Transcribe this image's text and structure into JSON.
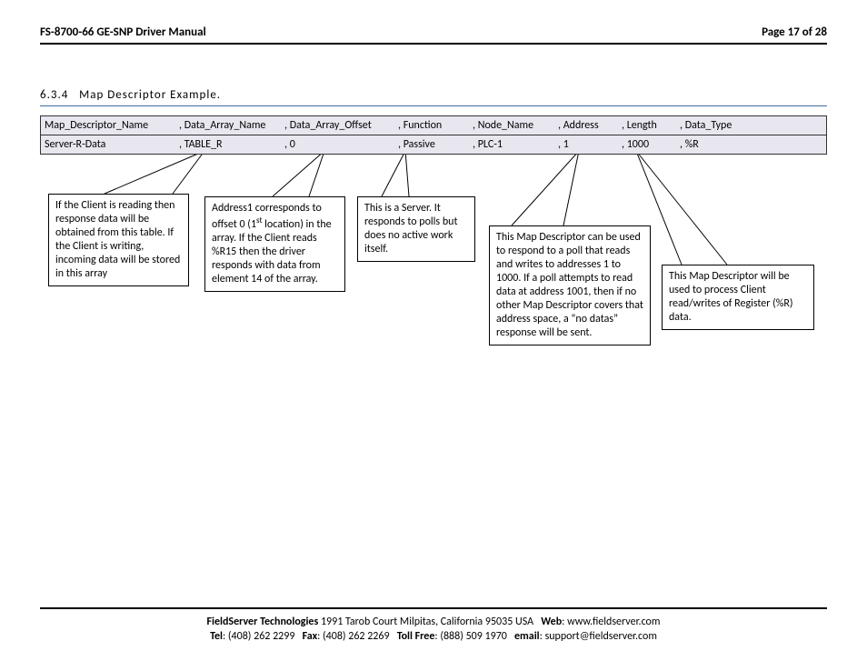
{
  "header": {
    "title": "FS-8700-66 GE-SNP Driver Manual",
    "page": "Page 17 of 28"
  },
  "section": {
    "number": "6.3.4",
    "title": "Map Descriptor Example."
  },
  "table": {
    "header": [
      "Map_Descriptor_Name",
      ", Data_Array_Name",
      ", Data_Array_Offset",
      ", Function",
      ", Node_Name",
      ", Address",
      ", Length",
      ", Data_Type"
    ],
    "row": [
      "Server-R-Data",
      ", TABLE_R",
      ", 0",
      ", Passive",
      ", PLC-1",
      ", 1",
      ", 1000",
      ", %R"
    ]
  },
  "callouts": [
    "If the Client is reading then response data will be obtained from this table. If the Client is writing, incoming data will be stored in this array",
    "Address1 corresponds to offset 0 (1st location) in the array. If the Client reads %R15 then the driver responds with data from element 14 of the array.",
    "This is a Server.  It responds to polls but does no active work itself.",
    "This Map Descriptor can be used to respond to a poll that reads and writes to addresses 1 to 1000.  If a poll attempts to read data at address 1001, then if no other Map Descriptor covers that address space, a “no datas” response will be sent.",
    "This Map Descriptor will be used to process Client read/writes of Register (%R) data."
  ],
  "footer": {
    "company": "FieldServer Technologies",
    "address": "1991 Tarob Court Milpitas, California 95035 USA",
    "web_label": "Web",
    "web": "www.fieldserver.com",
    "tel_label": "Tel",
    "tel": "(408) 262 2299",
    "fax_label": "Fax",
    "fax": "(408) 262 2269",
    "tollfree_label": "Toll Free",
    "tollfree": "(888) 509 1970",
    "email_label": "email",
    "email": "support@fieldserver.com"
  }
}
